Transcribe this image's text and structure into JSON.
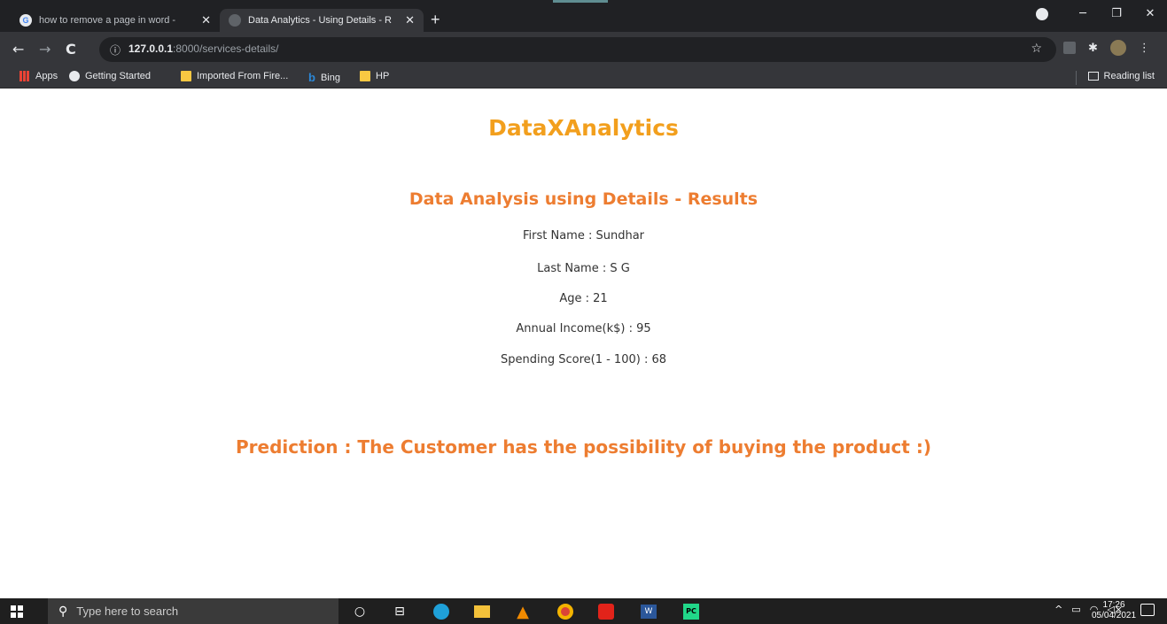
{
  "browser": {
    "tabs": [
      {
        "title": "how to remove a page in word -",
        "active": false
      },
      {
        "title": "Data Analytics - Using Details - R",
        "active": true
      }
    ],
    "new_tab_label": "+",
    "url_host": "127.0.0.1",
    "url_rest": ":8000/services-details/",
    "bookmarks": [
      {
        "label": "Apps",
        "icon": "apps-icon"
      },
      {
        "label": "Getting Started",
        "icon": "globe-icon"
      },
      {
        "label": "Imported From Fire...",
        "icon": "folder-icon"
      },
      {
        "label": "Bing",
        "icon": "bing-icon"
      },
      {
        "label": "HP",
        "icon": "folder-icon"
      }
    ],
    "reading_list_label": "Reading list"
  },
  "page": {
    "site_title": "DataXAnalytics",
    "results_heading": "Data Analysis using Details - Results",
    "fields": [
      "First Name : Sundhar",
      "Last Name : S G",
      "Age : 21",
      "Annual Income(k$) : 95",
      "Spending Score(1 - 100) : 68"
    ],
    "prediction": "Prediction : The Customer has the possibility of buying the product :)"
  },
  "taskbar": {
    "search_placeholder": "Type here to search",
    "time": "17:26",
    "date": "05/04/2021"
  },
  "colors": {
    "title": "#f29f1d",
    "heading": "#ed7d31",
    "browser_dark": "#202124",
    "toolbar": "#35363a"
  }
}
